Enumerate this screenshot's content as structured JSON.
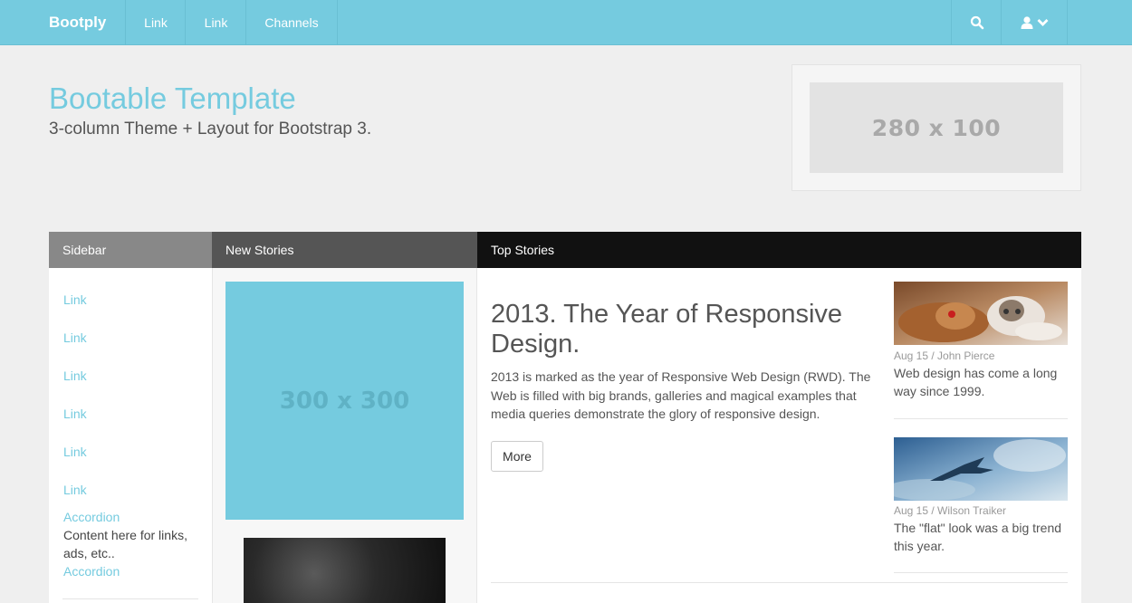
{
  "navbar": {
    "brand": "Bootply",
    "links": [
      "Link",
      "Link",
      "Channels"
    ],
    "search_icon": "search-icon",
    "user_icon": "user-icon",
    "chevron_icon": "chevron-down-icon",
    "color": "#75cbdf"
  },
  "header": {
    "title": "Bootable Template",
    "subtitle": "3-column Theme + Layout for Bootstrap 3.",
    "banner_text": "280 x 100"
  },
  "columns": {
    "sidebar": "Sidebar",
    "new_stories": "New Stories",
    "top_stories": "Top Stories"
  },
  "sidebar": {
    "links": [
      "Link",
      "Link",
      "Link",
      "Link",
      "Link",
      "Link"
    ],
    "accordion_1": "Accordion",
    "content": "Content here for links, ads, etc..",
    "accordion_2": "Accordion"
  },
  "new_stories": {
    "placeholder": "300 x 300"
  },
  "main": {
    "headline": "2013. The Year of Responsive Design.",
    "body": "2013 is marked as the year of Responsive Web Design (RWD). The Web is filled with big brands, galleries and magical examples that media queries demonstrate the glory of responsive design.",
    "more_label": "More"
  },
  "top_stories": [
    {
      "meta": "Aug 15 / John Pierce",
      "teaser": "Web design has come a long way since 1999."
    },
    {
      "meta": "Aug 15 / Wilson Traiker",
      "teaser": "The \"flat\" look was a big trend this year."
    }
  ]
}
